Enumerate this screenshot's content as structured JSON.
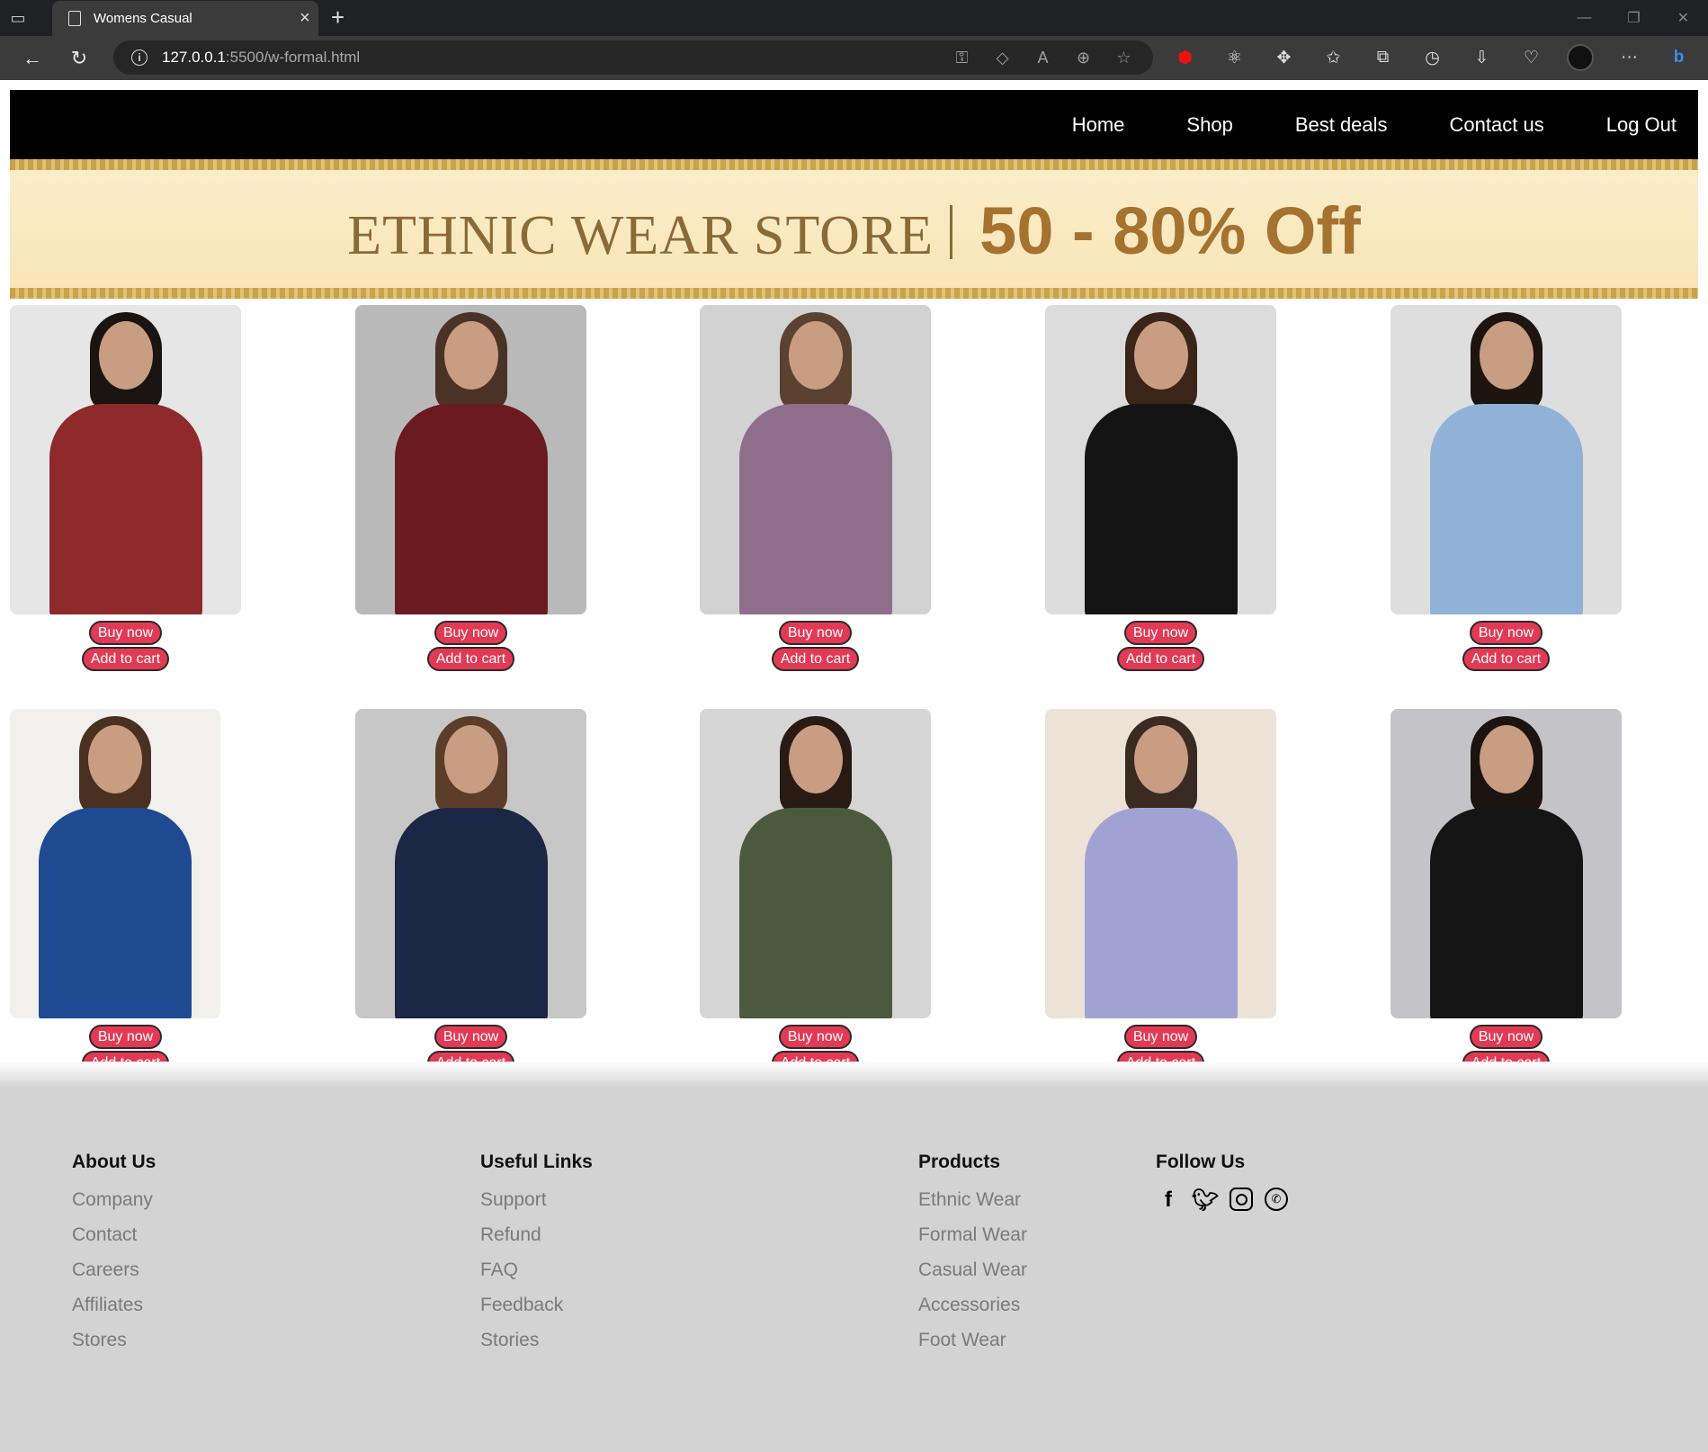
{
  "browser": {
    "tab_title": "Womens Casual",
    "url_host": "127.0.0.1",
    "url_rest": ":5500/w-formal.html"
  },
  "nav": {
    "links": [
      "Home",
      "Shop",
      "Best deals",
      "Contact us",
      "Log Out"
    ]
  },
  "banner": {
    "store_text": "ETHNIC WEAR STORE",
    "offer_text": "50 - 80% Off"
  },
  "products": [
    {
      "buy_label": "Buy now",
      "cart_label": "Add to cart",
      "bg": "#e6e6e6",
      "outfit": "#8e2a2c",
      "hair": "#1a1412",
      "item": "maroon blazer"
    },
    {
      "buy_label": "Buy now",
      "cart_label": "Add to cart",
      "bg": "#b9b9b9",
      "outfit": "#6b1a1f",
      "hair": "#4a3326",
      "item": "maroon shirt"
    },
    {
      "buy_label": "Buy now",
      "cart_label": "Add to cart",
      "bg": "#d2d2d2",
      "outfit": "#8d6f8c",
      "hair": "#5b4130",
      "item": "mauve shirt"
    },
    {
      "buy_label": "Buy now",
      "cart_label": "Add to cart",
      "bg": "#dcdcdc",
      "outfit": "#141414",
      "hair": "#3b2418",
      "item": "black dress"
    },
    {
      "buy_label": "Buy now",
      "cart_label": "Add to cart",
      "bg": "#dedede",
      "outfit": "#8fb2d6",
      "hair": "#1e1410",
      "item": "light blue blazer"
    },
    {
      "buy_label": "Buy now",
      "cart_label": "Add to cart",
      "bg": "#f1f0ed",
      "outfit": "#1d4a91",
      "hair": "#4a3020",
      "item": "royal blue blazer"
    },
    {
      "buy_label": "Buy now",
      "cart_label": "Add to cart",
      "bg": "#c7c7c7",
      "outfit": "#1c2645",
      "hair": "#5c3d2a",
      "item": "navy shirt"
    },
    {
      "buy_label": "Buy now",
      "cart_label": "Add to cart",
      "bg": "#d5d5d5",
      "outfit": "#4b5a3c",
      "hair": "#2a1a14",
      "item": "olive shirt"
    },
    {
      "buy_label": "Buy now",
      "cart_label": "Add to cart",
      "bg": "#ece3d6",
      "outfit": "#a1a2d4",
      "hair": "#3a2a22",
      "item": "lavender shirt"
    },
    {
      "buy_label": "Buy now",
      "cart_label": "Add to cart",
      "bg": "#c4c4c8",
      "outfit": "#151515",
      "hair": "#1c1410",
      "item": "black shirt"
    }
  ],
  "footer": {
    "about": {
      "title": "About Us",
      "links": [
        "Company",
        "Contact",
        "Careers",
        "Affiliates",
        "Stores"
      ]
    },
    "useful": {
      "title": "Useful Links",
      "links": [
        "Support",
        "Refund",
        "FAQ",
        "Feedback",
        "Stories"
      ]
    },
    "products": {
      "title": "Products",
      "links": [
        "Ethnic Wear",
        "Formal Wear",
        "Casual Wear",
        "Accessories",
        "Foot Wear"
      ]
    },
    "follow": {
      "title": "Follow Us",
      "icons": [
        "facebook-icon",
        "twitter-icon",
        "instagram-icon",
        "whatsapp-icon"
      ]
    }
  }
}
